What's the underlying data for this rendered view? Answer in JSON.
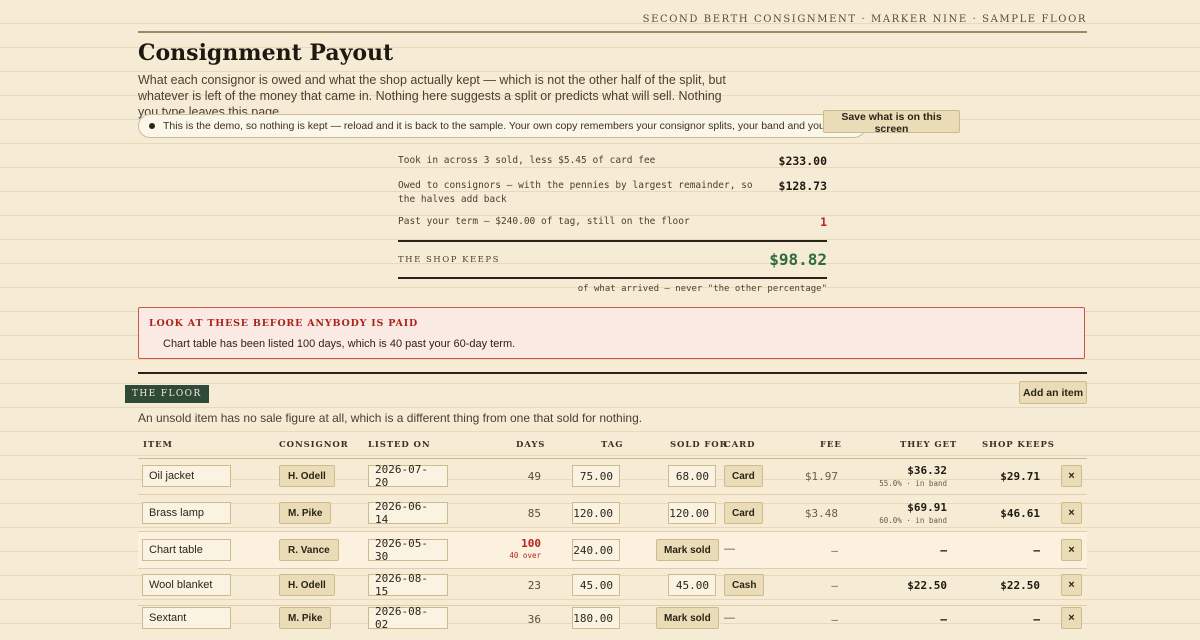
{
  "masthead": "SECOND BERTH CONSIGNMENT · MARKER NINE · SAMPLE FLOOR",
  "title": "Consignment Payout",
  "intro": "What each consignor is owed and what the shop actually kept — which is not the other half of the split, but whatever is left of the money that came in. Nothing here suggests a split or predicts what will sell. Nothing you type leaves this page.",
  "notice": "This is the demo, so nothing is kept — reload and it is back to the sample. Your own copy remembers your consignor splits, your band and your term.",
  "save_label": "Save what is on this screen",
  "summary": [
    {
      "label": "Took in across 3 sold, less $5.45 of card fee",
      "amount": "$233.00"
    },
    {
      "label": "Owed to consignors — with the pennies by largest remainder, so the halves add back",
      "amount": "$128.73"
    },
    {
      "label": "Past your term — $240.00 of tag, still on the floor",
      "amount": "1"
    }
  ],
  "keeps": {
    "label": "THE SHOP KEEPS",
    "value": "$98.82",
    "note": "of what arrived — never \"the other percentage\""
  },
  "alert": {
    "heading": "LOOK AT THESE BEFORE ANYBODY IS PAID",
    "body": "Chart table has been listed 100 days, which is 40 past your 60-day term."
  },
  "floor": {
    "tag": "THE FLOOR",
    "add_label": "Add an item",
    "note": "An unsold item has no sale figure at all, which is a different thing from one that sold for nothing."
  },
  "columns": {
    "item": "ITEM",
    "consignor": "CONSIGNOR",
    "listed": "LISTED ON",
    "days": "DAYS",
    "tag": "TAG",
    "sold": "SOLD FOR",
    "card": "CARD",
    "fee": "FEE",
    "gets": "THEY GET",
    "keeps": "SHOP KEEPS"
  },
  "rows": [
    {
      "item": "Oil jacket",
      "consignor": "H. Odell",
      "listed": "2026-07-20",
      "days": "49",
      "over": "",
      "tag": "75.00",
      "sold": "68.00",
      "pay": "Card",
      "fee": "$1.97",
      "gets": "$36.32",
      "band": "55.0% · in band",
      "keeps": "$29.71",
      "x": "×"
    },
    {
      "item": "Brass lamp",
      "consignor": "M. Pike",
      "listed": "2026-06-14",
      "days": "85",
      "over": "",
      "tag": "120.00",
      "sold": "120.00",
      "pay": "Card",
      "fee": "$3.48",
      "gets": "$69.91",
      "band": "60.0% · in band",
      "keeps": "$46.61",
      "x": "×"
    },
    {
      "item": "Chart table",
      "consignor": "R. Vance",
      "listed": "2026-05-30",
      "days": "100",
      "over": "40 over",
      "tag": "240.00",
      "mark": "Mark sold",
      "pay": "—",
      "fee": "—",
      "gets": "—",
      "keeps": "—",
      "x": "×"
    },
    {
      "item": "Wool blanket",
      "consignor": "H. Odell",
      "listed": "2026-08-15",
      "days": "23",
      "over": "",
      "tag": "45.00",
      "sold": "45.00",
      "pay": "Cash",
      "fee": "—",
      "gets": "$22.50",
      "band": "",
      "keeps": "$22.50",
      "x": "×"
    },
    {
      "item": "Sextant",
      "consignor": "M. Pike",
      "listed": "2026-08-02",
      "days": "36",
      "over": "",
      "tag": "180.00",
      "mark": "Mark sold",
      "pay": "—",
      "fee": "—",
      "gets": "—",
      "keeps": "—",
      "x": "×"
    }
  ]
}
